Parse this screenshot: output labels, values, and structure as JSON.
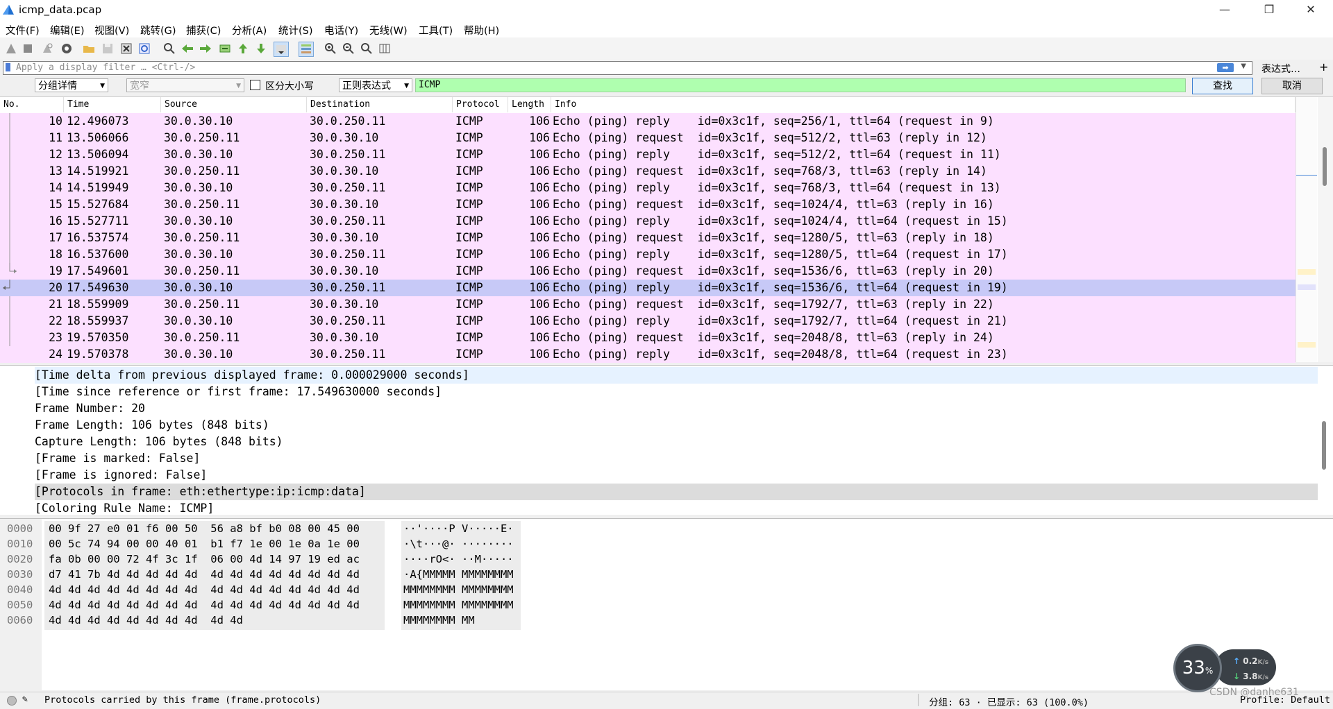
{
  "window": {
    "title": "icmp_data.pcap",
    "min": "—",
    "restore": "❐",
    "close": "✕"
  },
  "menu": [
    "文件(F)",
    "编辑(E)",
    "视图(V)",
    "跳转(G)",
    "捕获(C)",
    "分析(A)",
    "统计(S)",
    "电话(Y)",
    "无线(W)",
    "工具(T)",
    "帮助(H)"
  ],
  "filter": {
    "placeholder": "Apply a display filter … <Ctrl-/>",
    "expression_button": "表达式…",
    "plus": "+"
  },
  "find": {
    "scope": "分组详情",
    "charset": "宽窄",
    "case_label": "区分大小写",
    "mode": "正则表达式",
    "value": "ICMP",
    "find_button": "查找",
    "cancel_button": "取消"
  },
  "packet_list": {
    "columns": [
      "No.",
      "Time",
      "Source",
      "Destination",
      "Protocol",
      "Length",
      "Info"
    ],
    "rows": [
      {
        "no": "10",
        "time": "12.496073",
        "src": "30.0.30.10",
        "dst": "30.0.250.11",
        "proto": "ICMP",
        "len": "106",
        "info": "Echo (ping) reply    id=0x3c1f, seq=256/1, ttl=64 (request in 9)"
      },
      {
        "no": "11",
        "time": "13.506066",
        "src": "30.0.250.11",
        "dst": "30.0.30.10",
        "proto": "ICMP",
        "len": "106",
        "info": "Echo (ping) request  id=0x3c1f, seq=512/2, ttl=63 (reply in 12)"
      },
      {
        "no": "12",
        "time": "13.506094",
        "src": "30.0.30.10",
        "dst": "30.0.250.11",
        "proto": "ICMP",
        "len": "106",
        "info": "Echo (ping) reply    id=0x3c1f, seq=512/2, ttl=64 (request in 11)"
      },
      {
        "no": "13",
        "time": "14.519921",
        "src": "30.0.250.11",
        "dst": "30.0.30.10",
        "proto": "ICMP",
        "len": "106",
        "info": "Echo (ping) request  id=0x3c1f, seq=768/3, ttl=63 (reply in 14)"
      },
      {
        "no": "14",
        "time": "14.519949",
        "src": "30.0.30.10",
        "dst": "30.0.250.11",
        "proto": "ICMP",
        "len": "106",
        "info": "Echo (ping) reply    id=0x3c1f, seq=768/3, ttl=64 (request in 13)"
      },
      {
        "no": "15",
        "time": "15.527684",
        "src": "30.0.250.11",
        "dst": "30.0.30.10",
        "proto": "ICMP",
        "len": "106",
        "info": "Echo (ping) request  id=0x3c1f, seq=1024/4, ttl=63 (reply in 16)"
      },
      {
        "no": "16",
        "time": "15.527711",
        "src": "30.0.30.10",
        "dst": "30.0.250.11",
        "proto": "ICMP",
        "len": "106",
        "info": "Echo (ping) reply    id=0x3c1f, seq=1024/4, ttl=64 (request in 15)"
      },
      {
        "no": "17",
        "time": "16.537574",
        "src": "30.0.250.11",
        "dst": "30.0.30.10",
        "proto": "ICMP",
        "len": "106",
        "info": "Echo (ping) request  id=0x3c1f, seq=1280/5, ttl=63 (reply in 18)"
      },
      {
        "no": "18",
        "time": "16.537600",
        "src": "30.0.30.10",
        "dst": "30.0.250.11",
        "proto": "ICMP",
        "len": "106",
        "info": "Echo (ping) reply    id=0x3c1f, seq=1280/5, ttl=64 (request in 17)"
      },
      {
        "no": "19",
        "time": "17.549601",
        "src": "30.0.250.11",
        "dst": "30.0.30.10",
        "proto": "ICMP",
        "len": "106",
        "info": "Echo (ping) request  id=0x3c1f, seq=1536/6, ttl=63 (reply in 20)"
      },
      {
        "no": "20",
        "time": "17.549630",
        "src": "30.0.30.10",
        "dst": "30.0.250.11",
        "proto": "ICMP",
        "len": "106",
        "info": "Echo (ping) reply    id=0x3c1f, seq=1536/6, ttl=64 (request in 19)"
      },
      {
        "no": "21",
        "time": "18.559909",
        "src": "30.0.250.11",
        "dst": "30.0.30.10",
        "proto": "ICMP",
        "len": "106",
        "info": "Echo (ping) request  id=0x3c1f, seq=1792/7, ttl=63 (reply in 22)"
      },
      {
        "no": "22",
        "time": "18.559937",
        "src": "30.0.30.10",
        "dst": "30.0.250.11",
        "proto": "ICMP",
        "len": "106",
        "info": "Echo (ping) reply    id=0x3c1f, seq=1792/7, ttl=64 (request in 21)"
      },
      {
        "no": "23",
        "time": "19.570350",
        "src": "30.0.250.11",
        "dst": "30.0.30.10",
        "proto": "ICMP",
        "len": "106",
        "info": "Echo (ping) request  id=0x3c1f, seq=2048/8, ttl=63 (reply in 24)"
      },
      {
        "no": "24",
        "time": "19.570378",
        "src": "30.0.30.10",
        "dst": "30.0.250.11",
        "proto": "ICMP",
        "len": "106",
        "info": "Echo (ping) reply    id=0x3c1f, seq=2048/8, ttl=64 (request in 23)"
      }
    ],
    "selected_no": "20"
  },
  "details": [
    "[Time delta from previous displayed frame: 0.000029000 seconds]",
    "[Time since reference or first frame: 17.549630000 seconds]",
    "Frame Number: 20",
    "Frame Length: 106 bytes (848 bits)",
    "Capture Length: 106 bytes (848 bits)",
    "[Frame is marked: False]",
    "[Frame is ignored: False]",
    "[Protocols in frame: eth:ethertype:ip:icmp:data]",
    "[Coloring Rule Name: ICMP]"
  ],
  "bytes": {
    "offsets": [
      "0000",
      "0010",
      "0020",
      "0030",
      "0040",
      "0050",
      "0060"
    ],
    "hex": [
      "00 9f 27 e0 01 f6 00 50  56 a8 bf b0 08 00 45 00",
      "00 5c 74 94 00 00 40 01  b1 f7 1e 00 1e 0a 1e 00",
      "fa 0b 00 00 72 4f 3c 1f  06 00 4d 14 97 19 ed ac",
      "d7 41 7b 4d 4d 4d 4d 4d  4d 4d 4d 4d 4d 4d 4d 4d",
      "4d 4d 4d 4d 4d 4d 4d 4d  4d 4d 4d 4d 4d 4d 4d 4d",
      "4d 4d 4d 4d 4d 4d 4d 4d  4d 4d 4d 4d 4d 4d 4d 4d",
      "4d 4d 4d 4d 4d 4d 4d 4d  4d 4d"
    ],
    "ascii": [
      "··'····P V·····E·",
      "·\\t···@· ········",
      "····rO<· ··M·····",
      "·A{MMMMM MMMMMMMM",
      "MMMMMMMM MMMMMMMM",
      "MMMMMMMM MMMMMMMM",
      "MMMMMMMM MM"
    ]
  },
  "status": {
    "field_info": "Protocols carried by this frame (frame.protocols)",
    "packets": "分组: 63 · 已显示: 63 (100.0%)",
    "profile": "Profile: Default"
  },
  "speed_widget": {
    "percent": "33",
    "pct_sign": "%",
    "up": "0.2",
    "down": "3.8",
    "unit": "K/s"
  },
  "watermark": "CSDN @danhe631",
  "colors": {
    "row_icmp": "#fce0ff",
    "row_selected": "#c7c9f7",
    "find_input": "#afffaf"
  }
}
